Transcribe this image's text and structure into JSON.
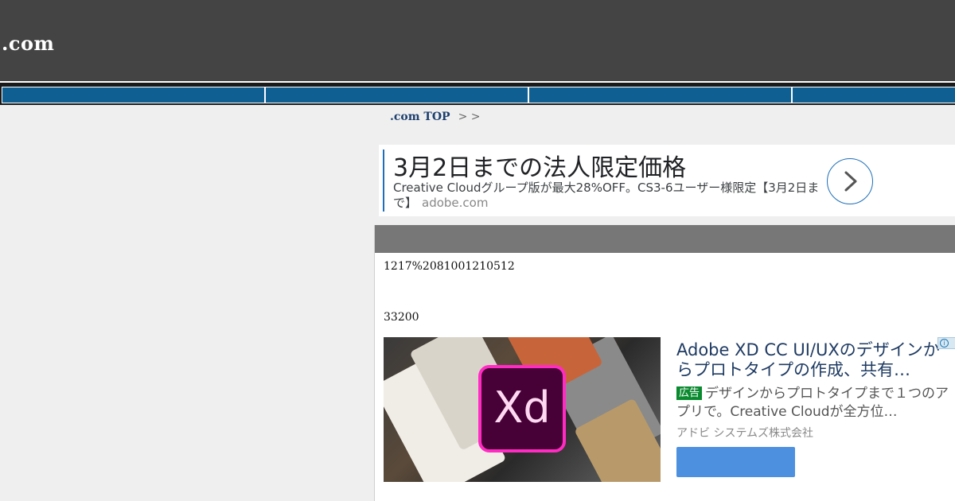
{
  "header": {
    "site_title": ".com"
  },
  "nav": {
    "items": [
      "",
      "",
      "",
      ""
    ]
  },
  "breadcrumb": {
    "home_label": ".com TOP",
    "separator": "> >"
  },
  "ad_top": {
    "headline": "3月2日までの法人限定価格",
    "description": "Creative Cloudグループ版が最大28%OFF。CS3-6ユーザー様限定【3月2日まで】",
    "domain": "adobe.com",
    "arrow_icon": "chevron-right-icon",
    "accent_color": "#1f6fb8"
  },
  "content": {
    "line1": "1217%2081001210512",
    "line2": "33200"
  },
  "ad_bottom": {
    "image_logo_text": "Xd",
    "headline": "Adobe XD CC UI/UXのデザインからプロトタイプの作成、共有…",
    "badge": "広告",
    "description": "デザインからプロトタイプまで１つのアプリで。Creative Cloudが全方位…",
    "advertiser": "アドビ システムズ株式会社",
    "cta_label": "",
    "cta_color": "#4d90e0",
    "info_icon": "info-icon"
  }
}
